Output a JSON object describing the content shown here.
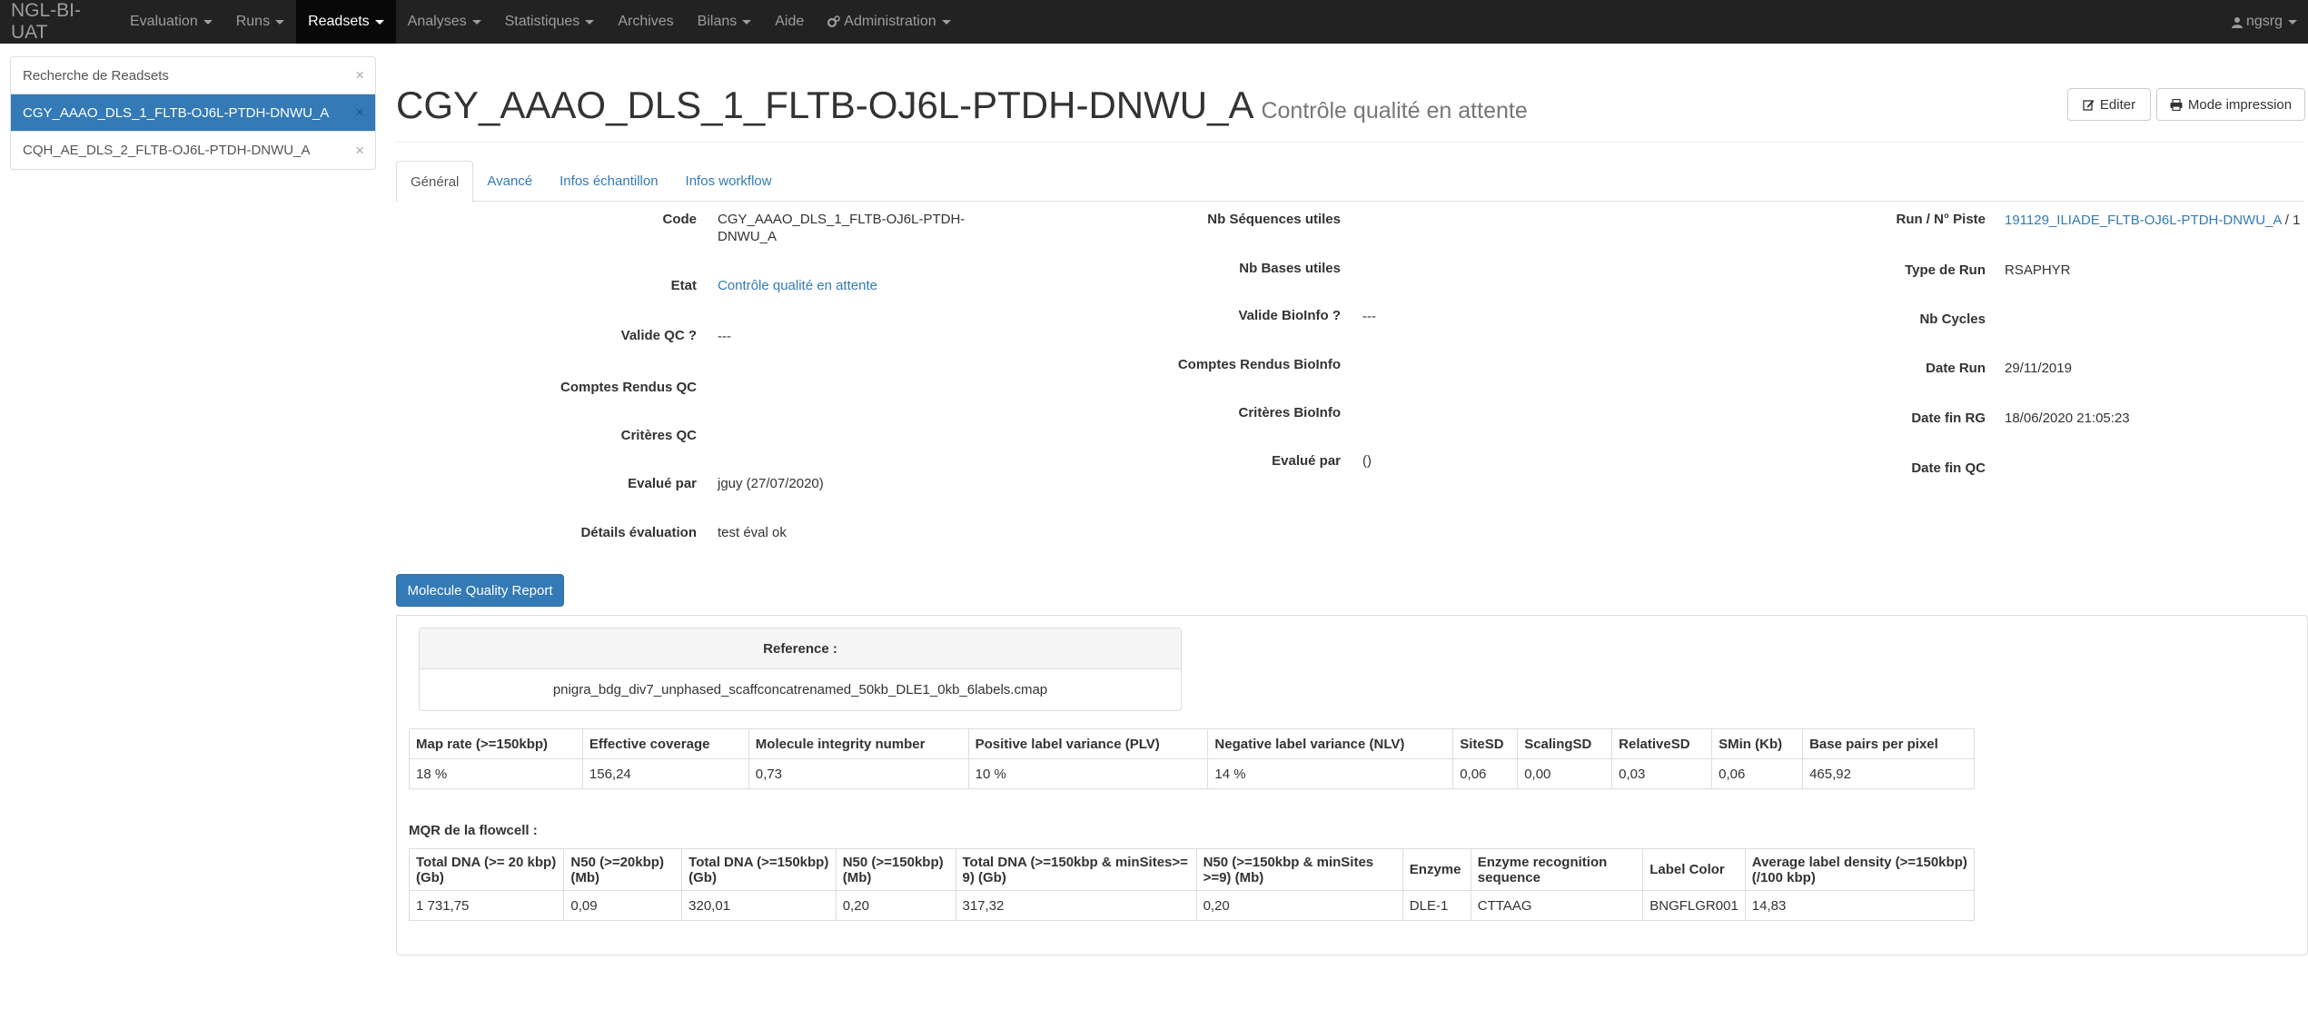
{
  "navbar": {
    "brand": "NGL-BI-UAT",
    "items": [
      {
        "label": "Evaluation",
        "caret": true
      },
      {
        "label": "Runs",
        "caret": true
      },
      {
        "label": "Readsets",
        "caret": true,
        "active": true
      },
      {
        "label": "Analyses",
        "caret": true
      },
      {
        "label": "Statistiques",
        "caret": true
      },
      {
        "label": "Archives",
        "caret": false
      },
      {
        "label": "Bilans",
        "caret": true
      },
      {
        "label": "Aide",
        "caret": false
      },
      {
        "label": "Administration",
        "caret": true,
        "icon": "gears-icon"
      }
    ],
    "user": "ngsrg"
  },
  "sidebar": {
    "search_label": "Recherche de Readsets",
    "items": [
      {
        "label": "CGY_AAAO_DLS_1_FLTB-OJ6L-PTDH-DNWU_A",
        "active": true
      },
      {
        "label": "CQH_AE_DLS_2_FLTB-OJ6L-PTDH-DNWU_A",
        "active": false
      }
    ],
    "close_glyph": "×"
  },
  "header": {
    "title": "CGY_AAAO_DLS_1_FLTB-OJ6L-PTDH-DNWU_A",
    "subtitle": "Contrôle qualité en attente",
    "edit_label": "Editer",
    "print_label": "Mode impression"
  },
  "tabs": [
    "Général",
    "Avancé",
    "Infos échantillon",
    "Infos workflow"
  ],
  "general": {
    "col1": [
      {
        "label": "Code",
        "value": "CGY_AAAO_DLS_1_FLTB-OJ6L-PTDH-DNWU_A"
      },
      {
        "label": "Etat",
        "value": "Contrôle qualité en attente"
      },
      {
        "label": "Valide QC ?",
        "value": "---"
      },
      {
        "label": "Comptes Rendus QC",
        "value": ""
      },
      {
        "label": "Critères QC",
        "value": ""
      },
      {
        "label": "Evalué par",
        "value": "jguy (27/07/2020)"
      },
      {
        "label": "Détails évaluation",
        "value": "test éval ok"
      }
    ],
    "col2": [
      {
        "label": "Nb Séquences utiles",
        "value": ""
      },
      {
        "label": "Nb Bases utiles",
        "value": ""
      },
      {
        "label": "Valide BioInfo ?",
        "value": "---"
      },
      {
        "label": "Comptes Rendus BioInfo",
        "value": ""
      },
      {
        "label": "Critères BioInfo",
        "value": ""
      },
      {
        "label": "Evalué par",
        "value": "()"
      }
    ],
    "col3": [
      {
        "label": "Run / N° Piste",
        "value": "191129_ILIADE_FLTB-OJ6L-PTDH-DNWU_A",
        "suffix": " / 1"
      },
      {
        "label": "Type de Run",
        "value": "RSAPHYR"
      },
      {
        "label": "Nb Cycles",
        "value": ""
      },
      {
        "label": "Date Run",
        "value": "29/11/2019"
      },
      {
        "label": "Date fin RG",
        "value": "18/06/2020 21:05:23"
      },
      {
        "label": "Date fin QC",
        "value": ""
      }
    ]
  },
  "mqr": {
    "button_label": "Molecule Quality Report",
    "reference_title": "Reference :",
    "reference_file": "pnigra_bdg_div7_unphased_scaffconcatrenamed_50kb_DLE1_0kb_6labels.cmap",
    "table1": {
      "headers": [
        "Map rate (>=150kbp)",
        "Effective coverage",
        "Molecule integrity number",
        "Positive label variance (PLV)",
        "Negative label variance (NLV)",
        "SiteSD",
        "ScalingSD",
        "RelativeSD",
        "SMin (Kb)",
        "Base pairs per pixel"
      ],
      "row": [
        "18 %",
        "156,24",
        "0,73",
        "10 %",
        "14 %",
        "0,06",
        "0,00",
        "0,03",
        "0,06",
        "465,92"
      ]
    },
    "flowcell_caption": "MQR de la flowcell :",
    "table2": {
      "headers": [
        "Total DNA (>= 20 kbp) (Gb)",
        "N50 (>=20kbp) (Mb)",
        "Total DNA (>=150kbp) (Gb)",
        "N50 (>=150kbp) (Mb)",
        "Total DNA (>=150kbp & minSites>= 9) (Gb)",
        "N50 (>=150kbp & minSites >=9) (Mb)",
        "Enzyme",
        "Enzyme recognition sequence",
        "Label Color",
        "Average label density (>=150kbp) (/100 kbp)"
      ],
      "row": [
        "1 731,75",
        "0,09",
        "320,01",
        "0,20",
        "317,32",
        "0,20",
        "DLE-1",
        "CTTAAG",
        "BNGFLGR001",
        "14,83"
      ]
    }
  }
}
